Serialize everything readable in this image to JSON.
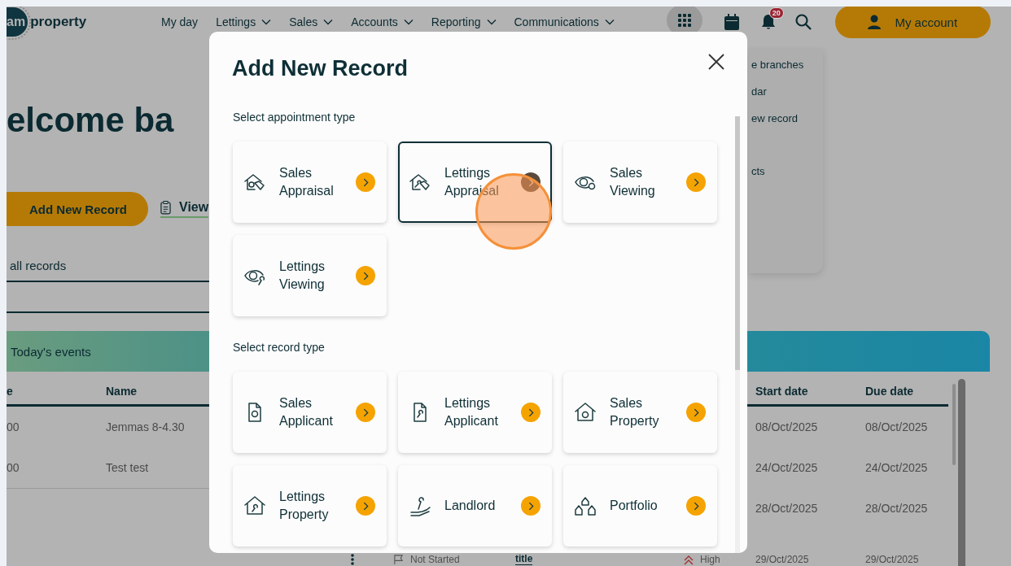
{
  "header": {
    "logo_mark": "am",
    "logo_text": "property",
    "nav": [
      {
        "label": "My day",
        "dropdown": false
      },
      {
        "label": "Lettings",
        "dropdown": true
      },
      {
        "label": "Sales",
        "dropdown": true
      },
      {
        "label": "Accounts",
        "dropdown": true
      },
      {
        "label": "Reporting",
        "dropdown": true
      },
      {
        "label": "Communications",
        "dropdown": true
      }
    ],
    "notification_count": "20",
    "account_button": "My account"
  },
  "page": {
    "heading": "elcome ba",
    "add_button": "Add New Record",
    "view_link": "View",
    "filter_label": "all records"
  },
  "menu": {
    "items": [
      "e branches",
      "dar",
      "ew record",
      "cts"
    ]
  },
  "events": {
    "title": "Today's events",
    "columns": {
      "column_1": "e",
      "name": "Name",
      "start_date": "Start date",
      "due_date": "Due date"
    },
    "rows": [
      {
        "column_1": "00",
        "name": "Jemmas 8-4.30",
        "start_date": "08/Oct/2025",
        "due_date": "08/Oct/2025"
      },
      {
        "column_1": "00",
        "name": "Test test",
        "start_date": "24/Oct/2025",
        "due_date": "24/Oct/2025"
      },
      {
        "start_date": "28/Oct/2025",
        "due_date": "28/Oct/2025"
      },
      {
        "status": "Not Started",
        "title": "title",
        "priority": "High",
        "start_date": "29/Oct/2025",
        "due_date": "29/Oct/2025"
      }
    ]
  },
  "modal": {
    "title": "Add New Record",
    "sections": [
      {
        "label": "Select appointment type",
        "options": [
          {
            "label": "Sales Appraisal",
            "kind": "house-tag-coin",
            "selected": false
          },
          {
            "label": "Lettings Appraisal",
            "kind": "house-tag-key",
            "selected": true
          },
          {
            "label": "Sales Viewing",
            "kind": "eye-coin",
            "selected": false
          },
          {
            "label": "Lettings Viewing",
            "kind": "eye-key",
            "selected": false
          }
        ]
      },
      {
        "label": "Select record type",
        "options": [
          {
            "label": "Sales Applicant",
            "kind": "document-coin",
            "selected": false
          },
          {
            "label": "Lettings Applicant",
            "kind": "document-key",
            "selected": false
          },
          {
            "label": "Sales Property",
            "kind": "house-coin",
            "selected": false
          },
          {
            "label": "Lettings Property",
            "kind": "house-key",
            "selected": false
          },
          {
            "label": "Landlord",
            "kind": "hand-key",
            "selected": false
          },
          {
            "label": "Portfolio",
            "kind": "houses",
            "selected": false
          }
        ]
      }
    ]
  }
}
